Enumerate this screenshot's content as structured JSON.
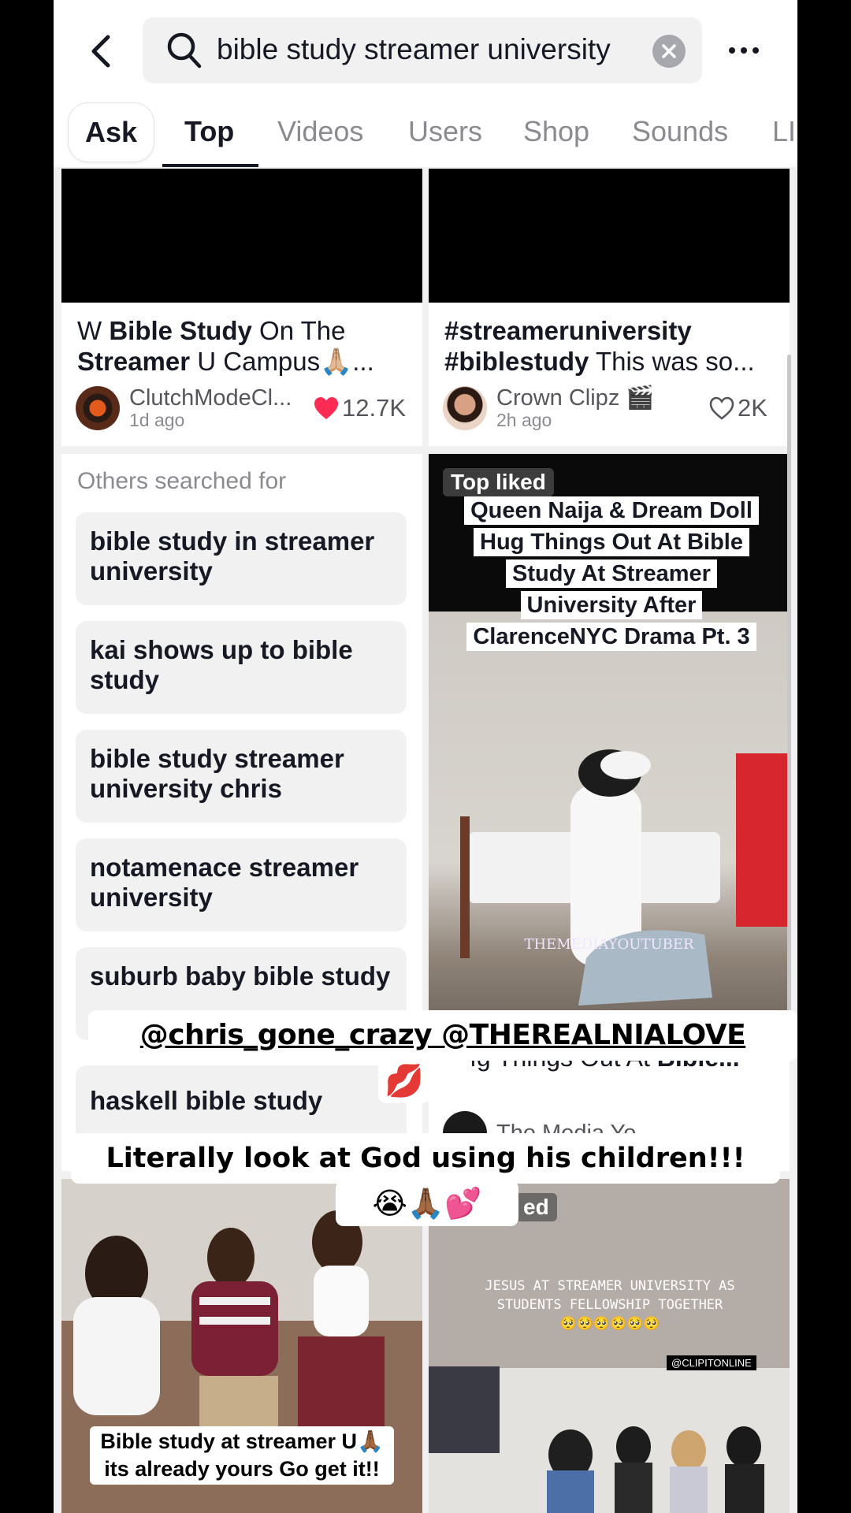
{
  "search": {
    "query": "bible study streamer university"
  },
  "tabs": [
    "Ask",
    "Top",
    "Videos",
    "Users",
    "Shop",
    "Sounds",
    "LI"
  ],
  "cards": [
    {
      "title_prefix": "W ",
      "title_bold1": "Bible Study",
      "title_mid": " On The ",
      "title_bold2": "Streamer",
      "title_suffix": " U Campus🙏🏼...",
      "author": "ClutchModeCl...",
      "time": "1d ago",
      "likes": "12.7K"
    },
    {
      "title_bold1": "#streameruniversity",
      "title_bold2": "#biblestudy",
      "title_suffix": " This was so...",
      "author": "Crown Clipz 🎬",
      "time": "2h ago",
      "likes": "2K"
    }
  ],
  "others": {
    "title": "Others searched for",
    "items": [
      "bible study in streamer university",
      "kai shows up to bible study",
      "bible study streamer university chris",
      "notamenace streamer university",
      "suburb baby bible study",
      "haskell bible study"
    ]
  },
  "top_liked": {
    "badge": "Top liked",
    "overlay": "Queen Naija & Dream Doll Hug Things Out At Bible Study At Streamer University After ClarenceNYC Drama Pt. 3",
    "watermark": "THEMEDIAYOUTUBER",
    "title_partial": "ıg Things Out At ",
    "title_bold": "Bible...",
    "author_partial": "The Media Yo"
  },
  "captions": {
    "mentions": "@chris_gone_crazy @THEREALNIALOVE",
    "kiss": "💋",
    "line": "Literally look at God using his children!!!",
    "emojis": "😭🙏🏾💕"
  },
  "bottom_left": {
    "caption_line1": "Bible study at streamer U🙏🏾",
    "caption_line2": "its already yours Go get it!!"
  },
  "bottom_right": {
    "badge_partial": "ed",
    "text": "JESUS AT STREAMER UNIVERSITY AS STUDENTS FELLOWSHIP TOGETHER",
    "text_emojis": "🥺🥺🥺🥺🥺🥺",
    "tag": "@CLIPITONLINE"
  },
  "colors": {
    "like_red": "#fe2c55",
    "bg": "#f1f1f2"
  }
}
